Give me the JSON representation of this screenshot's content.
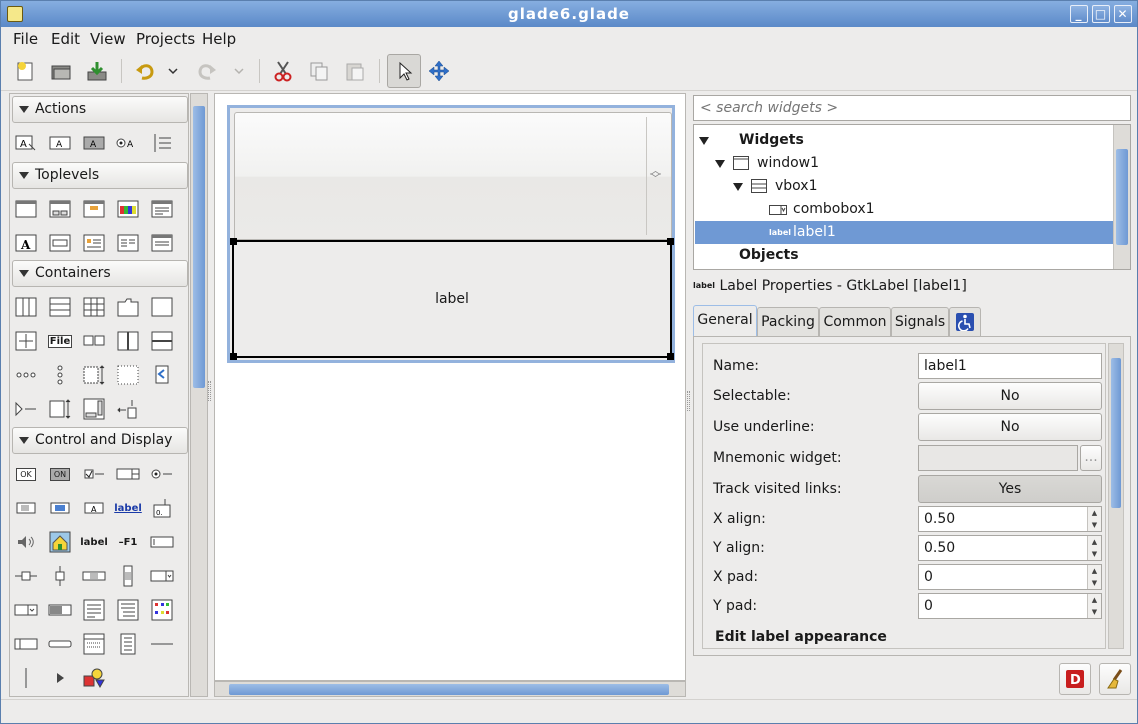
{
  "window": {
    "title": "glade6.glade",
    "minimize": "_",
    "maximize": "□",
    "close": "✕"
  },
  "menu": [
    {
      "label": "File"
    },
    {
      "label": "Edit"
    },
    {
      "label": "View"
    },
    {
      "label": "Projects"
    },
    {
      "label": "Help"
    }
  ],
  "toolbar": {
    "icons": [
      "new-icon",
      "open-icon",
      "save-icon",
      "undo-icon",
      "undo-dropdown-icon",
      "redo-icon",
      "redo-dropdown-icon",
      "cut-icon",
      "copy-icon",
      "paste-icon",
      "pointer-icon",
      "drag-resize-icon"
    ]
  },
  "palette": {
    "groups": [
      {
        "label": "Actions"
      },
      {
        "label": "Toplevels"
      },
      {
        "label": "Containers"
      },
      {
        "label": "Control and Display"
      }
    ],
    "glyphs": {
      "file": "File",
      "label_blue": "label",
      "label_bold": "label",
      "f1": "–F1",
      "ok": "OK",
      "on": "ON",
      "a": "A"
    }
  },
  "designer": {
    "label_text": "label"
  },
  "search": {
    "placeholder": "< search widgets >"
  },
  "tree": {
    "rows": [
      {
        "label": "Widgets"
      },
      {
        "label": "window1"
      },
      {
        "label": "vbox1"
      },
      {
        "label": "combobox1"
      },
      {
        "label": "label1"
      },
      {
        "label": "Objects"
      }
    ],
    "icon_text": "label"
  },
  "properties": {
    "header_icon": "label",
    "header": "Label Properties - GtkLabel [label1]",
    "tabs": [
      {
        "label": "General"
      },
      {
        "label": "Packing"
      },
      {
        "label": "Common"
      },
      {
        "label": "Signals"
      }
    ],
    "rows": {
      "name": {
        "label": "Name:",
        "value": "label1"
      },
      "selectable": {
        "label": "Selectable:",
        "value": "No"
      },
      "use_underline": {
        "label": "Use underline:",
        "value": "No"
      },
      "mnemonic": {
        "label": "Mnemonic widget:",
        "value": "",
        "ellipsis": "..."
      },
      "track_visited": {
        "label": "Track visited links:",
        "value": "Yes"
      },
      "xalign": {
        "label": "X align:",
        "value": "0.50"
      },
      "yalign": {
        "label": "Y align:",
        "value": "0.50"
      },
      "xpad": {
        "label": "X pad:",
        "value": "0"
      },
      "ypad": {
        "label": "Y pad:",
        "value": "0"
      }
    },
    "section": "Edit label appearance"
  },
  "colors": {
    "accent": "#6f99d4",
    "titlebar": "#5b89c8"
  }
}
